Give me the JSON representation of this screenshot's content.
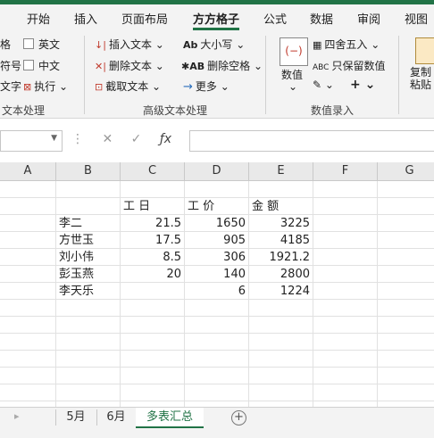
{
  "ribbon_tabs": [
    "开始",
    "插入",
    "页面布局",
    "方方格子",
    "公式",
    "数据",
    "审阅",
    "视图"
  ],
  "active_tab": "方方格子",
  "ribbon": {
    "group1": {
      "items": [
        "格",
        "符号",
        "文字"
      ],
      "checkbox_english": "英文",
      "checkbox_chinese": "中文",
      "execute": "执行",
      "label": "文本处理"
    },
    "group2": {
      "insert_text": "插入文本",
      "delete_text": "删除文本",
      "extract_text": "截取文本",
      "case": "大小写",
      "delete_space": "删除空格",
      "more": "更多",
      "label": "高级文本处理"
    },
    "group3": {
      "value": "数值",
      "round": "四舍五入",
      "keep_value": "只保留数值",
      "label": "数值录入"
    },
    "group4": {
      "copy_paste": "复制粘贴"
    }
  },
  "formula_bar": {
    "name_box": "",
    "formula": ""
  },
  "columns": [
    "A",
    "B",
    "C",
    "D",
    "E",
    "F",
    "G"
  ],
  "header_row": {
    "C": "工 日",
    "D": "工 价",
    "E": "金 额"
  },
  "rows": [
    {
      "name": "李二",
      "days": "21.5",
      "price": "1650",
      "amount": "3225"
    },
    {
      "name": "方世玉",
      "days": "17.5",
      "price": "905",
      "amount": "4185"
    },
    {
      "name": "刘小伟",
      "days": "8.5",
      "price": "306",
      "amount": "1921.2"
    },
    {
      "name": "彭玉燕",
      "days": "20",
      "price": "140",
      "amount": "2800"
    },
    {
      "name": "李天乐",
      "days": "",
      "price": "6",
      "amount": "1224"
    }
  ],
  "sheets": [
    "5月",
    "6月",
    "多表汇总"
  ],
  "active_sheet": "多表汇总"
}
